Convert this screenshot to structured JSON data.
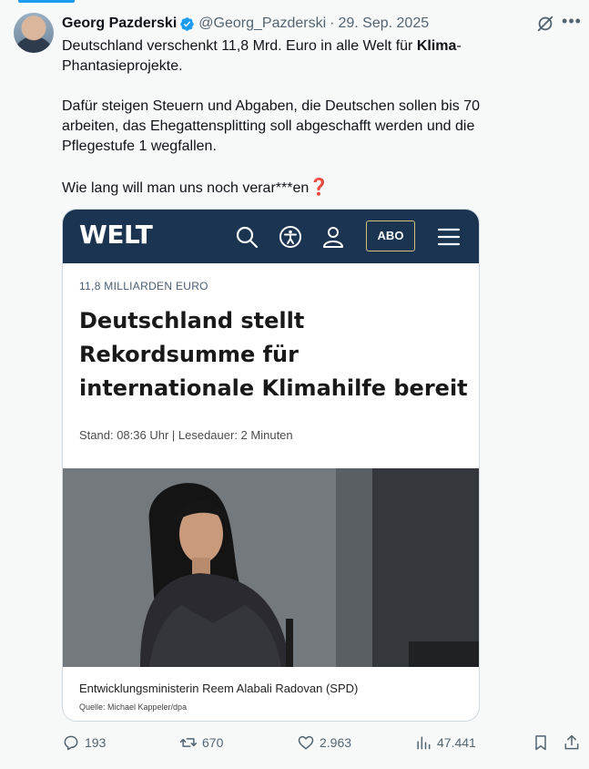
{
  "tweet": {
    "author_name": "Georg Pazderski",
    "handle": "@Georg_Pazderski",
    "separator": "·",
    "date": "29. Sep. 2025",
    "text_line1_pre": "Deutschland verschenkt 11,8 Mrd. Euro in alle Welt für ",
    "text_line1_bold": "Klima",
    "text_line1_post": "-",
    "text_line2": "Phantasieprojekte.",
    "text_para2": "Dafür steigen Steuern und Abgaben, die Deutschen sollen bis 70 arbeiten, das Ehegattensplitting soll abgeschafft werden und die Pflegestufe 1 wegfallen.",
    "text_para3": "Wie lang will man uns noch verar***en",
    "emoji": "❓"
  },
  "card": {
    "logo": "WELT",
    "abo_label": "ABO",
    "kicker": "11,8 MILLIARDEN EURO",
    "headline": "Deutschland stellt Rekordsumme für internationale Klimahilfe bereit",
    "meta": "Stand: 08:36 Uhr  |  Lesedauer: 2 Minuten",
    "caption": "Entwicklungsministerin Reem Alabali Radovan (SPD)",
    "credit": "Quelle: Michael Kappeler/dpa"
  },
  "actions": {
    "replies": "193",
    "reposts": "670",
    "likes": "2.963",
    "views": "47.441"
  },
  "colors": {
    "accent": "#1d9bf0",
    "welt_blue": "#1b3451",
    "muted": "#536471"
  }
}
